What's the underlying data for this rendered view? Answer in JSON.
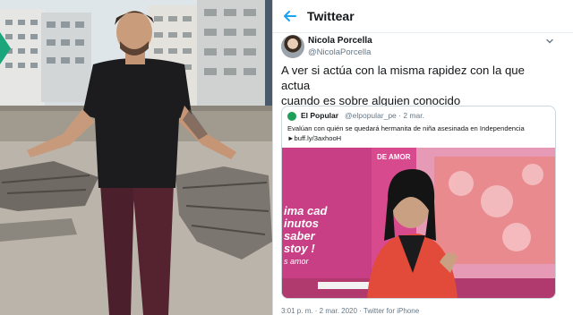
{
  "header": {
    "title": "Twittear"
  },
  "tweet": {
    "display_name": "Nicola Porcella",
    "handle": "@NicolaPorcella",
    "text_line1": "A ver si actúa con la misma rapidez con la que actua",
    "text_line2": "cuando es sobre alguien conocido",
    "footer": "3:01 p. m. · 2 mar. 2020 · Twitter for iPhone"
  },
  "quoted": {
    "name": "El Popular",
    "handle_date": "@elpopular_pe · 2 mar.",
    "text_line1": "Evalúan con quién se quedará hermanita de niña asesinada en Independencia",
    "text_line2": "►buff.ly/3axhooH",
    "image_text": {
      "top_right": "DE AMOR",
      "line1": "ima cad",
      "line2": "inutos",
      "line3": "saber",
      "line4": "stoy !",
      "line5": "s amor"
    }
  },
  "colors": {
    "accent": "#1da1f2",
    "text": "#14171a",
    "muted": "#657786",
    "border": "#ccd6dd",
    "image_pink": "#d24b8f"
  },
  "icons": {
    "back": "arrow-left-icon",
    "menu": "chevron-down-icon"
  }
}
